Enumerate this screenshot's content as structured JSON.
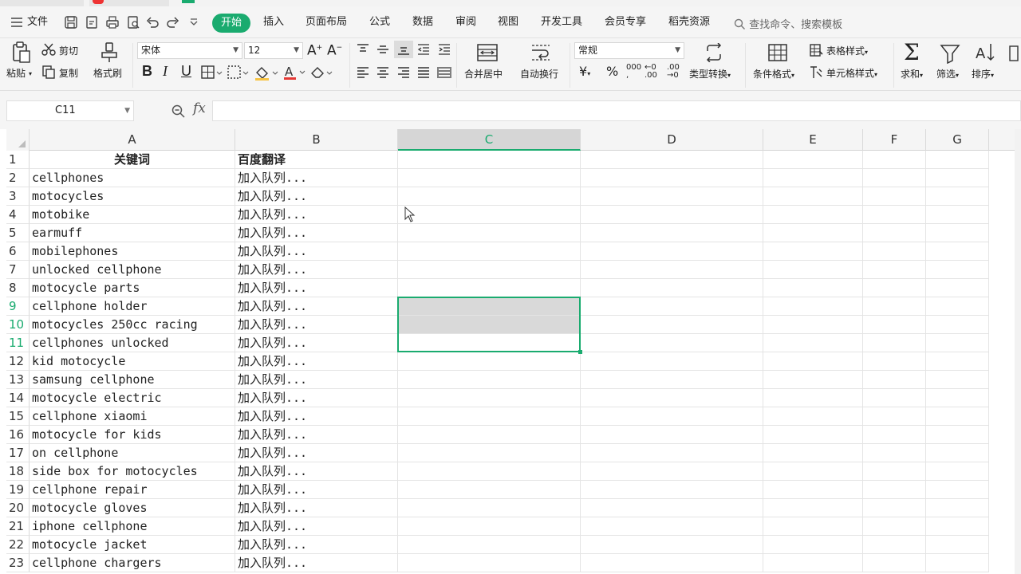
{
  "menubar": {
    "hamburger_label": "文件",
    "tabs": [
      "开始",
      "插入",
      "页面布局",
      "公式",
      "数据",
      "审阅",
      "视图",
      "开发工具",
      "会员专享",
      "稻壳资源"
    ],
    "active_tab": "开始",
    "search_placeholder": "查找命令、搜索模板"
  },
  "ribbon": {
    "paste": "粘贴",
    "cut": "剪切",
    "copy": "复制",
    "format_painter": "格式刷",
    "font_name": "宋体",
    "font_size": "12",
    "merge_center": "合并居中",
    "auto_wrap": "自动换行",
    "number_format": "常规",
    "type_convert": "类型转换",
    "conditional_format": "条件格式",
    "table_style": "表格样式",
    "cell_style": "单元格样式",
    "sum": "求和",
    "filter": "筛选",
    "sort": "排序",
    "currency": "¥",
    "percent": "%"
  },
  "formula_bar": {
    "cell_ref": "C11",
    "fx": "fx",
    "value": ""
  },
  "sheet": {
    "columns": [
      "A",
      "B",
      "C",
      "D",
      "E",
      "F",
      "G"
    ],
    "selected_column": "C",
    "rows": [
      {
        "n": "1",
        "a": "关键词",
        "b": "百度翻译"
      },
      {
        "n": "2",
        "a": "cellphones",
        "b": "加入队列..."
      },
      {
        "n": "3",
        "a": "motocycles",
        "b": "加入队列..."
      },
      {
        "n": "4",
        "a": "motobike",
        "b": "加入队列..."
      },
      {
        "n": "5",
        "a": "earmuff",
        "b": "加入队列..."
      },
      {
        "n": "6",
        "a": "mobilephones",
        "b": "加入队列..."
      },
      {
        "n": "7",
        "a": "unlocked cellphone",
        "b": "加入队列..."
      },
      {
        "n": "8",
        "a": "motocycle parts",
        "b": "加入队列..."
      },
      {
        "n": "9",
        "a": "cellphone holder",
        "b": "加入队列..."
      },
      {
        "n": "10",
        "a": "motocycles 250cc racing",
        "b": "加入队列..."
      },
      {
        "n": "11",
        "a": "cellphones unlocked",
        "b": "加入队列..."
      },
      {
        "n": "12",
        "a": "kid motocycle",
        "b": "加入队列..."
      },
      {
        "n": "13",
        "a": "samsung cellphone",
        "b": "加入队列..."
      },
      {
        "n": "14",
        "a": "motocycle electric",
        "b": "加入队列..."
      },
      {
        "n": "15",
        "a": "cellphone xiaomi",
        "b": "加入队列..."
      },
      {
        "n": "16",
        "a": "motocycle for kids",
        "b": "加入队列..."
      },
      {
        "n": "17",
        "a": "on cellphone",
        "b": "加入队列..."
      },
      {
        "n": "18",
        "a": "side box for motocycles",
        "b": "加入队列..."
      },
      {
        "n": "19",
        "a": "cellphone repair",
        "b": "加入队列..."
      },
      {
        "n": "20",
        "a": "motocycle gloves",
        "b": "加入队列..."
      },
      {
        "n": "21",
        "a": "iphone cellphone",
        "b": "加入队列..."
      },
      {
        "n": "22",
        "a": "motocycle jacket",
        "b": "加入队列..."
      },
      {
        "n": "23",
        "a": "cellphone chargers",
        "b": "加入队列..."
      }
    ],
    "selected_rows": [
      "9",
      "10",
      "11"
    ],
    "accent_color": "#1aab6f"
  }
}
